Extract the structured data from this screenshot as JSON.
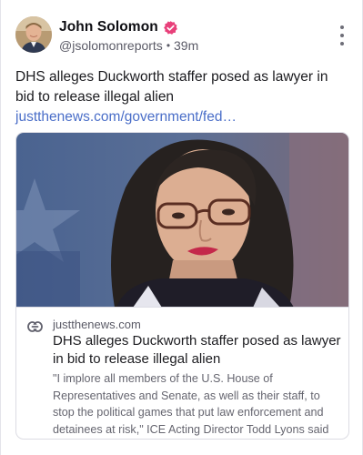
{
  "post": {
    "author": {
      "name": "John Solomon",
      "handle": "@jsolomonreports",
      "time": "39m",
      "verified": true
    },
    "text": "DHS alleges Duckworth staffer posed as lawyer in bid to release illegal alien ",
    "link_text": "justthenews.com/government/fed…",
    "embed": {
      "domain": "justthenews.com",
      "title": "DHS alleges Duckworth staffer posed as lawyer in bid to release illegal alien",
      "description": "\"I implore all members of the U.S. House of Representatives and Senate, as well as their staff, to stop the political games that put law enforcement and detainees at risk,\" ICE Acting Director Todd Lyons said"
    }
  },
  "colors": {
    "link": "#4a6ec8",
    "verified_badge": "#e8407a",
    "text": "#1b1b1f",
    "muted": "#5a5a66"
  },
  "icons": {
    "verified": "verified-badge-icon",
    "more": "more-options-icon",
    "link": "link-chain-icon"
  }
}
